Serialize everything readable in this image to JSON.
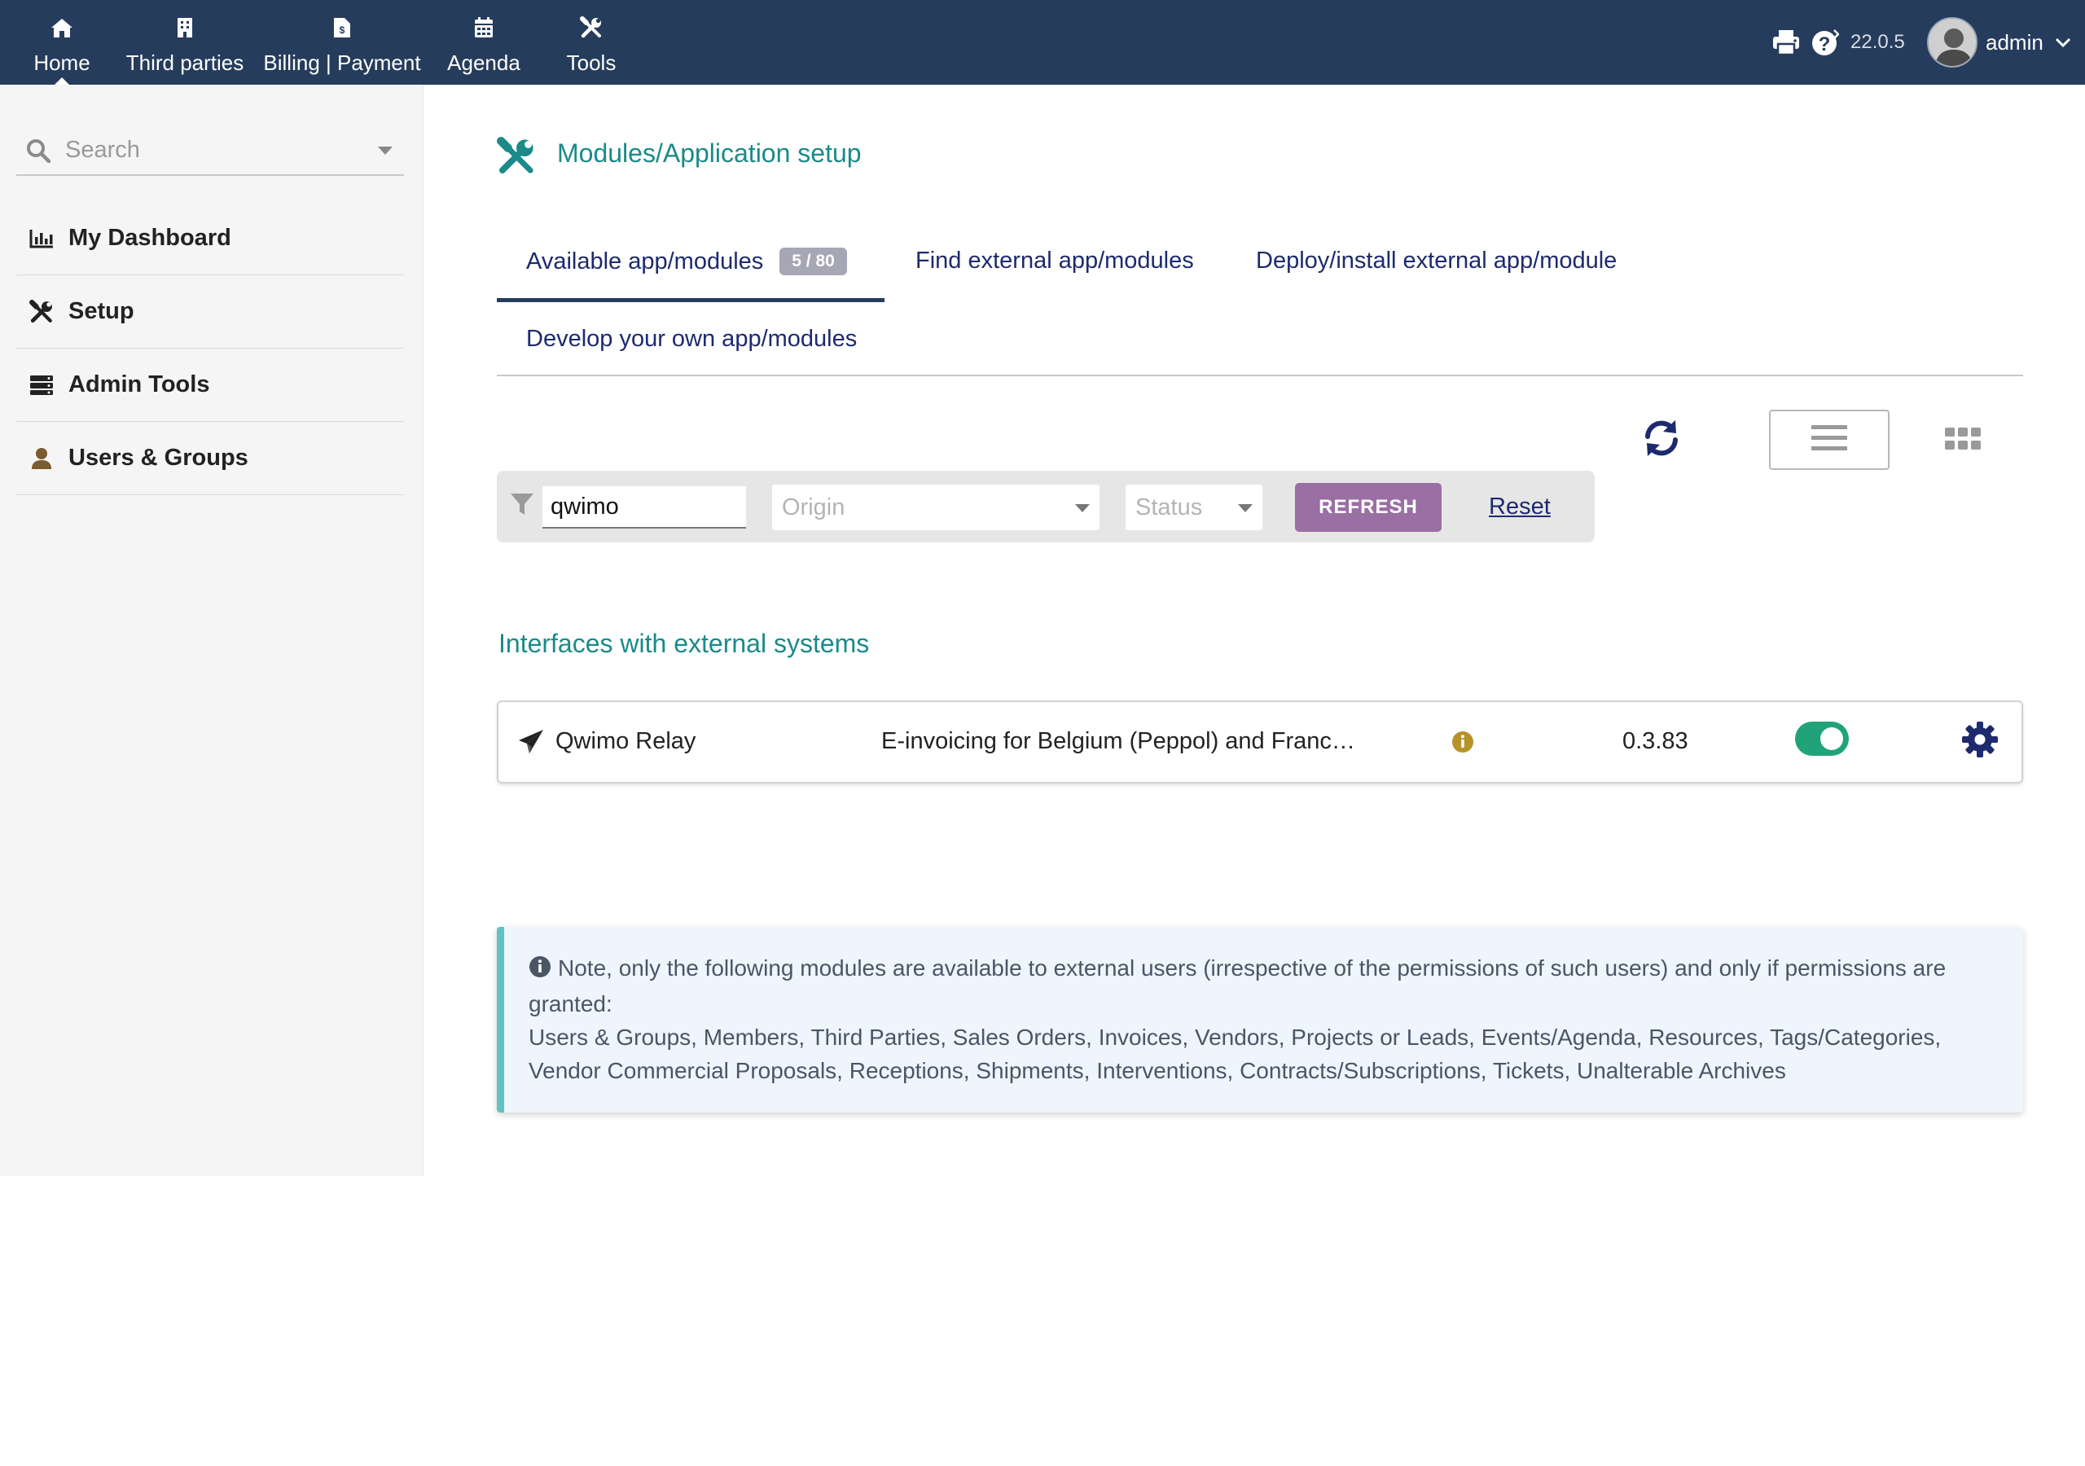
{
  "topbar": {
    "menu": [
      {
        "label": "Home",
        "icon": "home-icon",
        "active": true
      },
      {
        "label": "Third parties",
        "icon": "building-icon"
      },
      {
        "label": "Billing | Payment",
        "icon": "invoice-icon"
      },
      {
        "label": "Agenda",
        "icon": "calendar-icon"
      },
      {
        "label": "Tools",
        "icon": "tools-icon"
      }
    ],
    "version": "22.0.5",
    "user": "admin"
  },
  "sidebar": {
    "search_placeholder": "Search",
    "items": [
      {
        "label": "My Dashboard",
        "icon": "chart-icon"
      },
      {
        "label": "Setup",
        "icon": "tools-icon"
      },
      {
        "label": "Admin Tools",
        "icon": "server-icon"
      },
      {
        "label": "Users & Groups",
        "icon": "user-icon"
      }
    ]
  },
  "main": {
    "title": "Modules/Application setup",
    "tabs": [
      {
        "label": "Available app/modules",
        "badge": "5 / 80",
        "active": true
      },
      {
        "label": "Find external app/modules"
      },
      {
        "label": "Deploy/install external app/module"
      },
      {
        "label": "Develop your own app/modules"
      }
    ],
    "filter": {
      "search_value": "qwimo",
      "origin_placeholder": "Origin",
      "status_placeholder": "Status",
      "refresh_label": "REFRESH",
      "reset_label": "Reset"
    },
    "section_title": "Interfaces with external systems",
    "module": {
      "name": "Qwimo Relay",
      "description": "E-invoicing for Belgium (Peppol) and Franc…",
      "version": "0.3.83",
      "enabled": true
    },
    "note": {
      "line1": "Note, only the following modules are available to external users (irrespective of the permissions of such users) and only if permissions are granted:",
      "line2": "Users & Groups, Members, Third Parties, Sales Orders, Invoices, Vendors, Projects or Leads, Events/Agenda, Resources, Tags/Categories, Vendor Commercial Proposals, Receptions, Shipments, Interventions, Contracts/Subscriptions, Tickets, Unalterable Archives"
    }
  },
  "colors": {
    "topbar_bg": "#263c5c",
    "accent_teal": "#1b8a8a",
    "link_navy": "#1d2a6e",
    "refresh_button": "#9a6fa4",
    "toggle_on": "#21a37a",
    "note_border": "#62c3c3"
  }
}
